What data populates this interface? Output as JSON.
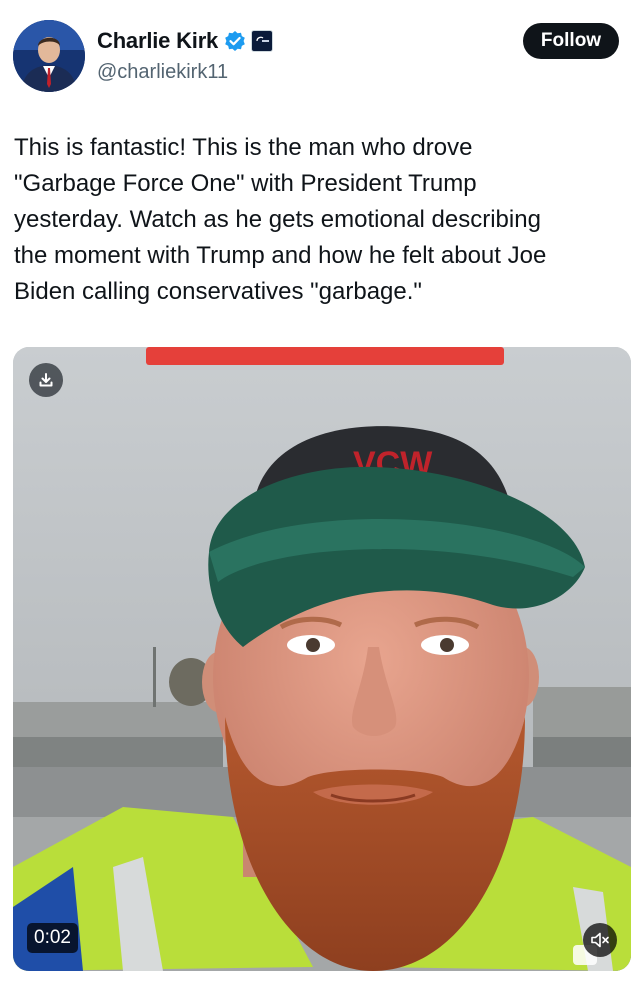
{
  "author": {
    "display_name": "Charlie Kirk",
    "handle": "@charliekirk11",
    "verified_icon": "verified-badge-icon",
    "affiliation_icon": "affiliate-logo-icon",
    "avatar_icon": "profile-avatar"
  },
  "header": {
    "follow_label": "Follow"
  },
  "tweet": {
    "lines": [
      "This is fantastic! This is the man who drove",
      "\"Garbage Force One\" with President Trump",
      "yesterday. Watch as he gets emotional describing",
      "the moment with Trump and how he felt about Joe",
      "Biden calling conservatives \"garbage.\""
    ]
  },
  "video": {
    "duration": "0:02",
    "download_icon": "download-icon",
    "mute_icon": "speaker-muted-icon",
    "hat_logo": "VCW"
  },
  "colors": {
    "follow_bg": "#0f1419",
    "verified_blue": "#1d9bf0",
    "text_primary": "#0f1419",
    "text_secondary": "#536471"
  }
}
